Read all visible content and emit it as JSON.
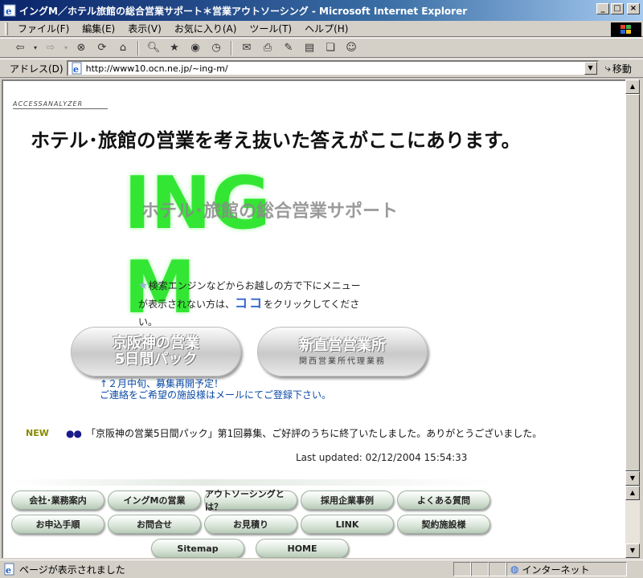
{
  "window": {
    "title": "イングM／ホテル旅館の総合営業サポート＊営業アウトソーシング - Microsoft Internet Explorer",
    "controls": {
      "minimize": "_",
      "maximize": "□",
      "close": "×"
    }
  },
  "menubar": {
    "items": [
      {
        "label": "ファイル(F)"
      },
      {
        "label": "編集(E)"
      },
      {
        "label": "表示(V)"
      },
      {
        "label": "お気に入り(A)"
      },
      {
        "label": "ツール(T)"
      },
      {
        "label": "ヘルプ(H)"
      }
    ]
  },
  "toolbar": {
    "buttons": [
      "back-icon",
      "forward-icon",
      "stop-icon",
      "refresh-icon",
      "home-icon",
      "search-icon",
      "favorites-icon",
      "media-icon",
      "history-icon",
      "mail-icon",
      "print-icon",
      "edit-icon",
      "discuss-icon",
      "messenger-icon"
    ]
  },
  "addressbar": {
    "label": "アドレス(D)",
    "url": "http://www10.ocn.ne.jp/~ing-m/",
    "go_label": "移動"
  },
  "page": {
    "access_analyzer": "ACCESSANALYZER",
    "headline": "ホテル･旅館の営業を考え抜いた答えがここにあります。",
    "logo": {
      "text": "ING M",
      "sub": "ホテル･旅館の総合営業サポート",
      "color": "#33e633"
    },
    "note": {
      "star": "★",
      "line1": "検索エンジンなどからお越しの方で下にメニュー",
      "line2_pre": "が表示されない方は、",
      "koko": "ココ",
      "line2_post": "をクリックしてくださ",
      "line3": "い。"
    },
    "promo_left": {
      "line1": "京阪神の営業",
      "line2": "5日間パック"
    },
    "promo_right": {
      "line1": "新直営営業所",
      "line2": "関西営業所代理業務"
    },
    "recruit": {
      "line1": "↑２月中旬、募集再開予定！",
      "line2": "ご連絡をご希望の施設様はメールにてご登録下さい。"
    },
    "news": {
      "badge": "NEW",
      "bullet": "●●",
      "text": "「京阪神の営業5日間パック」第1回募集、ご好評のうちに終了いたしました。ありがとうございました。"
    },
    "last_updated": "Last updated: 02/12/2004 15:54:33"
  },
  "nav": {
    "row1": [
      "会社･業務案内",
      "イングMの営業",
      "アウトソーシングとは？",
      "採用企業事例",
      "よくある質問"
    ],
    "row2": [
      "お申込手順",
      "お問合せ",
      "お見積り",
      "LINK",
      "契約施設様"
    ],
    "row3": [
      "Sitemap",
      "HOME"
    ]
  },
  "status": {
    "text": "ページが表示されました",
    "zone": "インターネット"
  }
}
